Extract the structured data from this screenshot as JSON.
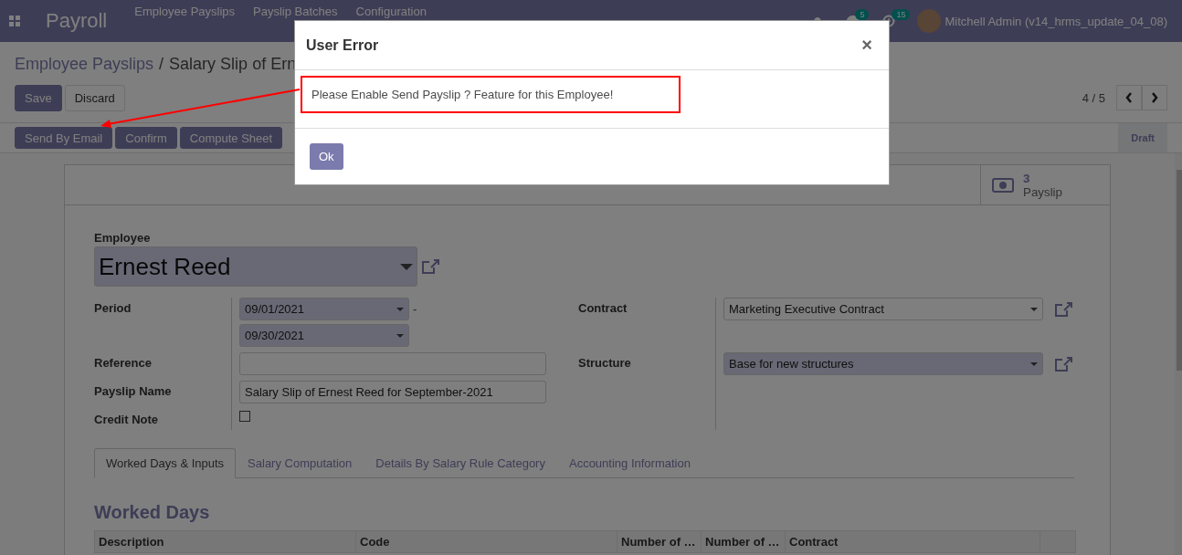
{
  "navbar": {
    "app_name": "Payroll",
    "menu": [
      "Employee Payslips",
      "Payslip Batches",
      "Configuration"
    ],
    "messages_count": "5",
    "activities_count": "15",
    "user": "Mitchell Admin (v14_hrms_update_04_08)"
  },
  "breadcrumb": {
    "items": [
      "Employee Payslips",
      "Salary Slip of Ern"
    ],
    "separator": "/"
  },
  "edit_buttons": [
    {
      "label": "Save",
      "kind": "primary"
    },
    {
      "label": "Discard",
      "kind": "secondary"
    }
  ],
  "pager": {
    "value": "4 / 5"
  },
  "action_buttons": [
    "Send By Email",
    "Confirm",
    "Compute Sheet"
  ],
  "status_stages": [
    {
      "label": "Draft",
      "selected": true
    }
  ],
  "smart_button": {
    "count": "3",
    "label": "Payslip"
  },
  "employee": {
    "label": "Employee",
    "value": "Ernest Reed"
  },
  "period": {
    "label": "Period",
    "date_from": "09/01/2021",
    "date_to": "09/30/2021",
    "separator": "-"
  },
  "reference": {
    "label": "Reference"
  },
  "payslip_name": {
    "label": "Payslip Name",
    "value": "Salary Slip of Ernest Reed for September-2021"
  },
  "credit_note": {
    "label": "Credit Note",
    "checked": false
  },
  "right_fields": [
    {
      "label": "Contract",
      "value": "Marketing Executive Contract",
      "required": false
    },
    {
      "label": "Structure",
      "value": "Base for new structures",
      "required": true
    }
  ],
  "tabs": [
    {
      "label": "Worked Days & Inputs",
      "selected": true
    },
    {
      "label": "Salary Computation",
      "selected": false
    },
    {
      "label": "Details By Salary Rule Category",
      "selected": false
    },
    {
      "label": "Accounting Information",
      "selected": false
    }
  ],
  "section_title": "Worked Days",
  "table": {
    "columns": [
      "Description",
      "Code",
      "Number of …",
      "Number of …",
      "Contract"
    ]
  },
  "dialog": {
    "title": "User Error",
    "close": "×",
    "message": "Please Enable Send Payslip ? Feature for this Employee!",
    "highlighted": true,
    "button": "Ok"
  }
}
